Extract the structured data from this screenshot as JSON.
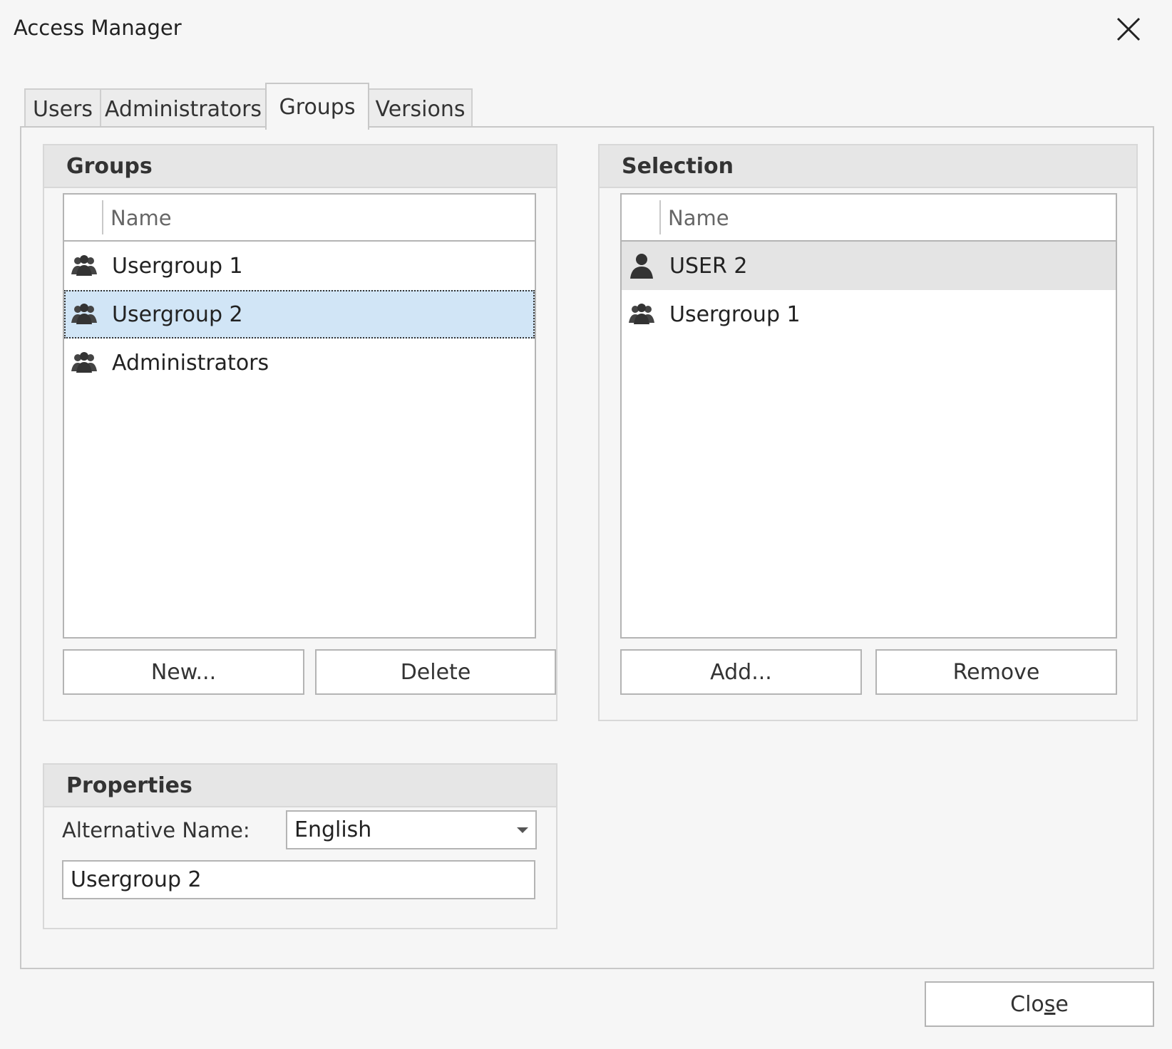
{
  "window": {
    "title": "Access Manager",
    "close_icon": "close-icon"
  },
  "tabs": [
    {
      "label": "Users",
      "active": false
    },
    {
      "label": "Administrators",
      "active": false
    },
    {
      "label": "Groups",
      "active": true
    },
    {
      "label": "Versions",
      "active": false
    }
  ],
  "groups_panel": {
    "title": "Groups",
    "column_header": "Name",
    "rows": [
      {
        "label": "Usergroup 1",
        "icon": "group-icon",
        "state": "normal"
      },
      {
        "label": "Usergroup 2",
        "icon": "group-icon",
        "state": "selected"
      },
      {
        "label": "Administrators",
        "icon": "group-icon",
        "state": "normal"
      }
    ],
    "new_button": "New...",
    "delete_button": "Delete"
  },
  "selection_panel": {
    "title": "Selection",
    "column_header": "Name",
    "rows": [
      {
        "label": "USER 2",
        "icon": "user-icon",
        "state": "hover"
      },
      {
        "label": "Usergroup 1",
        "icon": "group-icon",
        "state": "normal"
      }
    ],
    "add_button": "Add...",
    "remove_button": "Remove"
  },
  "properties_panel": {
    "title": "Properties",
    "alt_name_label": "Alternative Name:",
    "language_value": "English",
    "name_value": "Usergroup 2"
  },
  "footer": {
    "close_button_pre": "Clo",
    "close_button_mnemonic": "s",
    "close_button_post": "e"
  },
  "colors": {
    "selected_row": "#d1e5f6",
    "hover_row": "#e4e4e4",
    "header_bg": "#e6e6e6"
  }
}
